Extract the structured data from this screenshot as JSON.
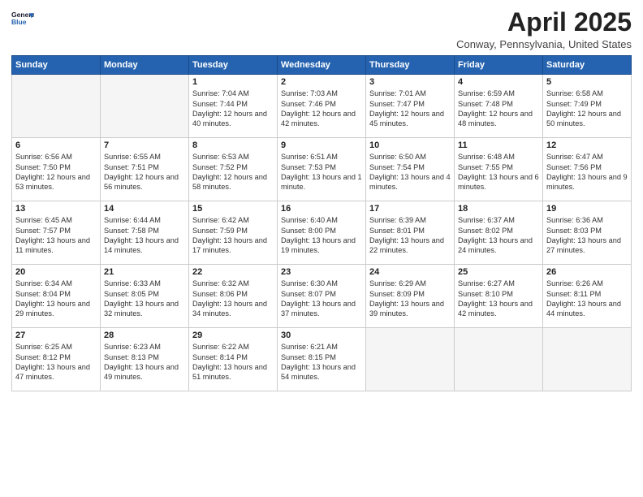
{
  "header": {
    "logo_line1": "General",
    "logo_line2": "Blue",
    "month_title": "April 2025",
    "location": "Conway, Pennsylvania, United States"
  },
  "weekdays": [
    "Sunday",
    "Monday",
    "Tuesday",
    "Wednesday",
    "Thursday",
    "Friday",
    "Saturday"
  ],
  "weeks": [
    [
      {
        "day": "",
        "empty": true
      },
      {
        "day": "",
        "empty": true
      },
      {
        "day": "1",
        "sunrise": "Sunrise: 7:04 AM",
        "sunset": "Sunset: 7:44 PM",
        "daylight": "Daylight: 12 hours and 40 minutes."
      },
      {
        "day": "2",
        "sunrise": "Sunrise: 7:03 AM",
        "sunset": "Sunset: 7:46 PM",
        "daylight": "Daylight: 12 hours and 42 minutes."
      },
      {
        "day": "3",
        "sunrise": "Sunrise: 7:01 AM",
        "sunset": "Sunset: 7:47 PM",
        "daylight": "Daylight: 12 hours and 45 minutes."
      },
      {
        "day": "4",
        "sunrise": "Sunrise: 6:59 AM",
        "sunset": "Sunset: 7:48 PM",
        "daylight": "Daylight: 12 hours and 48 minutes."
      },
      {
        "day": "5",
        "sunrise": "Sunrise: 6:58 AM",
        "sunset": "Sunset: 7:49 PM",
        "daylight": "Daylight: 12 hours and 50 minutes."
      }
    ],
    [
      {
        "day": "6",
        "sunrise": "Sunrise: 6:56 AM",
        "sunset": "Sunset: 7:50 PM",
        "daylight": "Daylight: 12 hours and 53 minutes."
      },
      {
        "day": "7",
        "sunrise": "Sunrise: 6:55 AM",
        "sunset": "Sunset: 7:51 PM",
        "daylight": "Daylight: 12 hours and 56 minutes."
      },
      {
        "day": "8",
        "sunrise": "Sunrise: 6:53 AM",
        "sunset": "Sunset: 7:52 PM",
        "daylight": "Daylight: 12 hours and 58 minutes."
      },
      {
        "day": "9",
        "sunrise": "Sunrise: 6:51 AM",
        "sunset": "Sunset: 7:53 PM",
        "daylight": "Daylight: 13 hours and 1 minute."
      },
      {
        "day": "10",
        "sunrise": "Sunrise: 6:50 AM",
        "sunset": "Sunset: 7:54 PM",
        "daylight": "Daylight: 13 hours and 4 minutes."
      },
      {
        "day": "11",
        "sunrise": "Sunrise: 6:48 AM",
        "sunset": "Sunset: 7:55 PM",
        "daylight": "Daylight: 13 hours and 6 minutes."
      },
      {
        "day": "12",
        "sunrise": "Sunrise: 6:47 AM",
        "sunset": "Sunset: 7:56 PM",
        "daylight": "Daylight: 13 hours and 9 minutes."
      }
    ],
    [
      {
        "day": "13",
        "sunrise": "Sunrise: 6:45 AM",
        "sunset": "Sunset: 7:57 PM",
        "daylight": "Daylight: 13 hours and 11 minutes."
      },
      {
        "day": "14",
        "sunrise": "Sunrise: 6:44 AM",
        "sunset": "Sunset: 7:58 PM",
        "daylight": "Daylight: 13 hours and 14 minutes."
      },
      {
        "day": "15",
        "sunrise": "Sunrise: 6:42 AM",
        "sunset": "Sunset: 7:59 PM",
        "daylight": "Daylight: 13 hours and 17 minutes."
      },
      {
        "day": "16",
        "sunrise": "Sunrise: 6:40 AM",
        "sunset": "Sunset: 8:00 PM",
        "daylight": "Daylight: 13 hours and 19 minutes."
      },
      {
        "day": "17",
        "sunrise": "Sunrise: 6:39 AM",
        "sunset": "Sunset: 8:01 PM",
        "daylight": "Daylight: 13 hours and 22 minutes."
      },
      {
        "day": "18",
        "sunrise": "Sunrise: 6:37 AM",
        "sunset": "Sunset: 8:02 PM",
        "daylight": "Daylight: 13 hours and 24 minutes."
      },
      {
        "day": "19",
        "sunrise": "Sunrise: 6:36 AM",
        "sunset": "Sunset: 8:03 PM",
        "daylight": "Daylight: 13 hours and 27 minutes."
      }
    ],
    [
      {
        "day": "20",
        "sunrise": "Sunrise: 6:34 AM",
        "sunset": "Sunset: 8:04 PM",
        "daylight": "Daylight: 13 hours and 29 minutes."
      },
      {
        "day": "21",
        "sunrise": "Sunrise: 6:33 AM",
        "sunset": "Sunset: 8:05 PM",
        "daylight": "Daylight: 13 hours and 32 minutes."
      },
      {
        "day": "22",
        "sunrise": "Sunrise: 6:32 AM",
        "sunset": "Sunset: 8:06 PM",
        "daylight": "Daylight: 13 hours and 34 minutes."
      },
      {
        "day": "23",
        "sunrise": "Sunrise: 6:30 AM",
        "sunset": "Sunset: 8:07 PM",
        "daylight": "Daylight: 13 hours and 37 minutes."
      },
      {
        "day": "24",
        "sunrise": "Sunrise: 6:29 AM",
        "sunset": "Sunset: 8:09 PM",
        "daylight": "Daylight: 13 hours and 39 minutes."
      },
      {
        "day": "25",
        "sunrise": "Sunrise: 6:27 AM",
        "sunset": "Sunset: 8:10 PM",
        "daylight": "Daylight: 13 hours and 42 minutes."
      },
      {
        "day": "26",
        "sunrise": "Sunrise: 6:26 AM",
        "sunset": "Sunset: 8:11 PM",
        "daylight": "Daylight: 13 hours and 44 minutes."
      }
    ],
    [
      {
        "day": "27",
        "sunrise": "Sunrise: 6:25 AM",
        "sunset": "Sunset: 8:12 PM",
        "daylight": "Daylight: 13 hours and 47 minutes."
      },
      {
        "day": "28",
        "sunrise": "Sunrise: 6:23 AM",
        "sunset": "Sunset: 8:13 PM",
        "daylight": "Daylight: 13 hours and 49 minutes."
      },
      {
        "day": "29",
        "sunrise": "Sunrise: 6:22 AM",
        "sunset": "Sunset: 8:14 PM",
        "daylight": "Daylight: 13 hours and 51 minutes."
      },
      {
        "day": "30",
        "sunrise": "Sunrise: 6:21 AM",
        "sunset": "Sunset: 8:15 PM",
        "daylight": "Daylight: 13 hours and 54 minutes."
      },
      {
        "day": "",
        "empty": true
      },
      {
        "day": "",
        "empty": true
      },
      {
        "day": "",
        "empty": true
      }
    ]
  ]
}
